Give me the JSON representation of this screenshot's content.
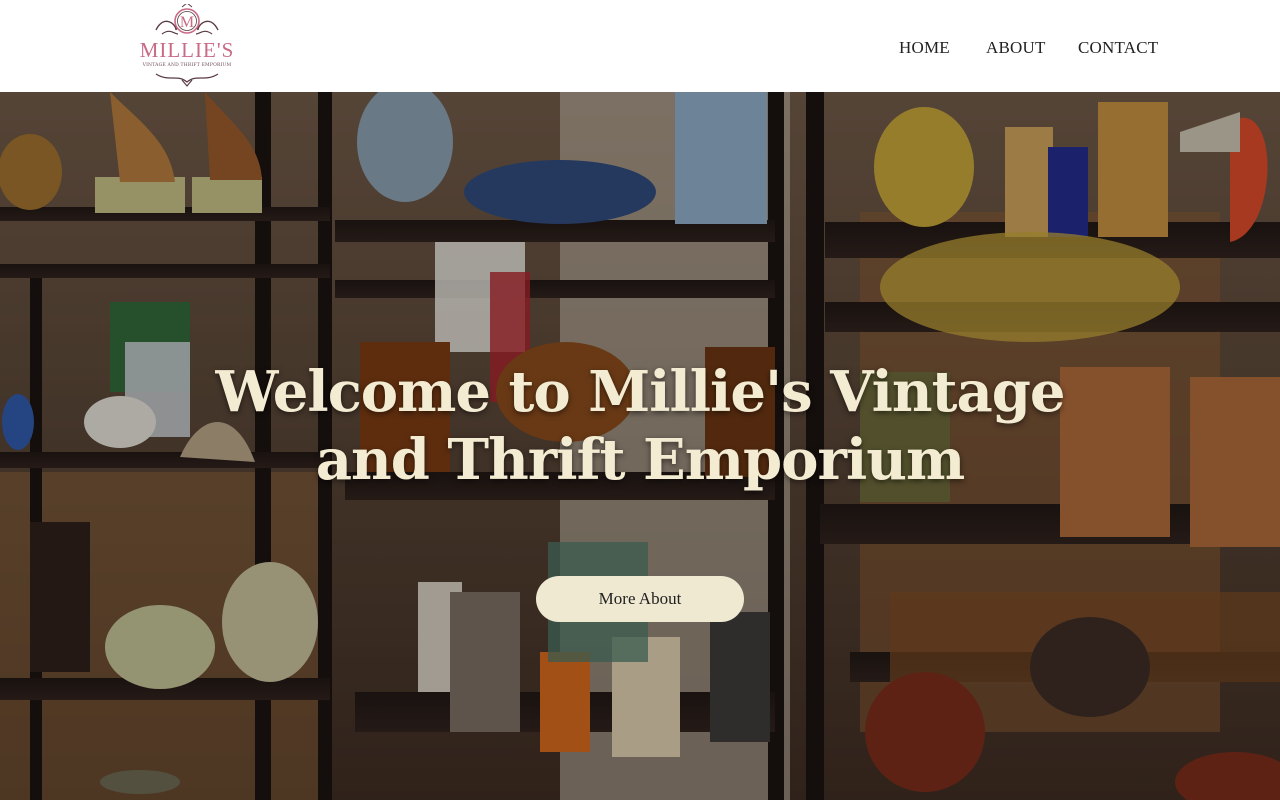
{
  "brand": {
    "monogram": "M",
    "name": "MILLIE'S",
    "tagline": "VINTAGE AND THRIFT EMPORIUM"
  },
  "nav": {
    "items": [
      {
        "label": "HOME"
      },
      {
        "label": "ABOUT"
      },
      {
        "label": "CONTACT"
      }
    ]
  },
  "hero": {
    "title": "Welcome to Millie's Vintage and Thrift Emporium",
    "button_label": "More About"
  },
  "colors": {
    "brand_pink": "#c96a86",
    "hero_text": "#f3ecd2",
    "button_bg": "#efe9d2"
  }
}
